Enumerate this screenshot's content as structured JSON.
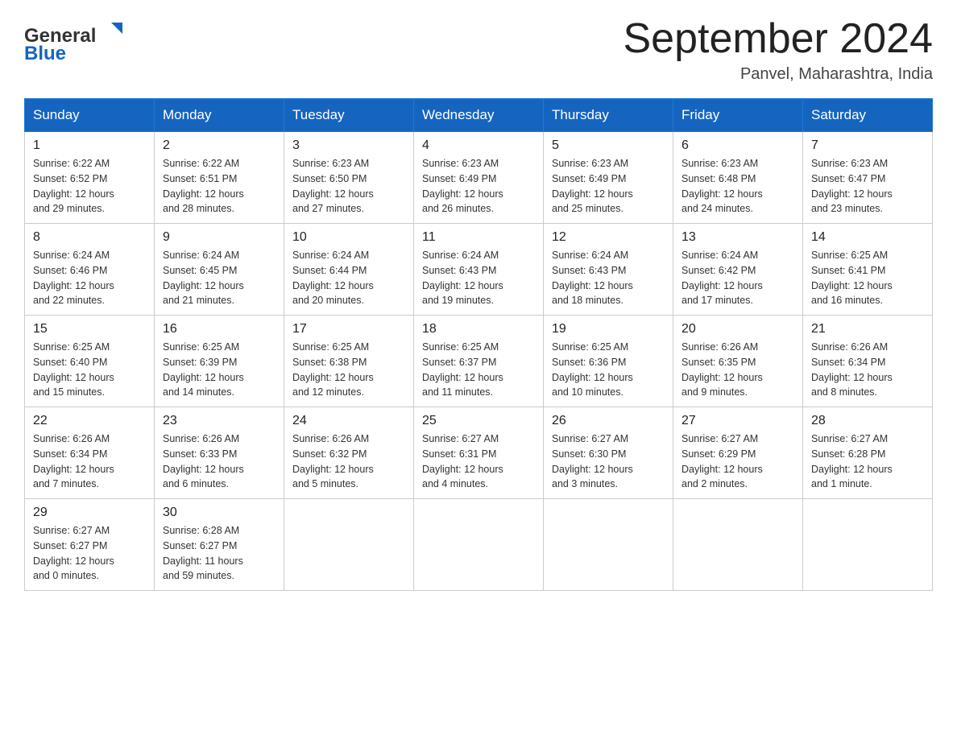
{
  "header": {
    "logo_text_general": "General",
    "logo_text_blue": "Blue",
    "month_title": "September 2024",
    "location": "Panvel, Maharashtra, India"
  },
  "weekdays": [
    "Sunday",
    "Monday",
    "Tuesday",
    "Wednesday",
    "Thursday",
    "Friday",
    "Saturday"
  ],
  "weeks": [
    [
      {
        "day": "1",
        "sunrise": "6:22 AM",
        "sunset": "6:52 PM",
        "daylight": "12 hours and 29 minutes."
      },
      {
        "day": "2",
        "sunrise": "6:22 AM",
        "sunset": "6:51 PM",
        "daylight": "12 hours and 28 minutes."
      },
      {
        "day": "3",
        "sunrise": "6:23 AM",
        "sunset": "6:50 PM",
        "daylight": "12 hours and 27 minutes."
      },
      {
        "day": "4",
        "sunrise": "6:23 AM",
        "sunset": "6:49 PM",
        "daylight": "12 hours and 26 minutes."
      },
      {
        "day": "5",
        "sunrise": "6:23 AM",
        "sunset": "6:49 PM",
        "daylight": "12 hours and 25 minutes."
      },
      {
        "day": "6",
        "sunrise": "6:23 AM",
        "sunset": "6:48 PM",
        "daylight": "12 hours and 24 minutes."
      },
      {
        "day": "7",
        "sunrise": "6:23 AM",
        "sunset": "6:47 PM",
        "daylight": "12 hours and 23 minutes."
      }
    ],
    [
      {
        "day": "8",
        "sunrise": "6:24 AM",
        "sunset": "6:46 PM",
        "daylight": "12 hours and 22 minutes."
      },
      {
        "day": "9",
        "sunrise": "6:24 AM",
        "sunset": "6:45 PM",
        "daylight": "12 hours and 21 minutes."
      },
      {
        "day": "10",
        "sunrise": "6:24 AM",
        "sunset": "6:44 PM",
        "daylight": "12 hours and 20 minutes."
      },
      {
        "day": "11",
        "sunrise": "6:24 AM",
        "sunset": "6:43 PM",
        "daylight": "12 hours and 19 minutes."
      },
      {
        "day": "12",
        "sunrise": "6:24 AM",
        "sunset": "6:43 PM",
        "daylight": "12 hours and 18 minutes."
      },
      {
        "day": "13",
        "sunrise": "6:24 AM",
        "sunset": "6:42 PM",
        "daylight": "12 hours and 17 minutes."
      },
      {
        "day": "14",
        "sunrise": "6:25 AM",
        "sunset": "6:41 PM",
        "daylight": "12 hours and 16 minutes."
      }
    ],
    [
      {
        "day": "15",
        "sunrise": "6:25 AM",
        "sunset": "6:40 PM",
        "daylight": "12 hours and 15 minutes."
      },
      {
        "day": "16",
        "sunrise": "6:25 AM",
        "sunset": "6:39 PM",
        "daylight": "12 hours and 14 minutes."
      },
      {
        "day": "17",
        "sunrise": "6:25 AM",
        "sunset": "6:38 PM",
        "daylight": "12 hours and 12 minutes."
      },
      {
        "day": "18",
        "sunrise": "6:25 AM",
        "sunset": "6:37 PM",
        "daylight": "12 hours and 11 minutes."
      },
      {
        "day": "19",
        "sunrise": "6:25 AM",
        "sunset": "6:36 PM",
        "daylight": "12 hours and 10 minutes."
      },
      {
        "day": "20",
        "sunrise": "6:26 AM",
        "sunset": "6:35 PM",
        "daylight": "12 hours and 9 minutes."
      },
      {
        "day": "21",
        "sunrise": "6:26 AM",
        "sunset": "6:34 PM",
        "daylight": "12 hours and 8 minutes."
      }
    ],
    [
      {
        "day": "22",
        "sunrise": "6:26 AM",
        "sunset": "6:34 PM",
        "daylight": "12 hours and 7 minutes."
      },
      {
        "day": "23",
        "sunrise": "6:26 AM",
        "sunset": "6:33 PM",
        "daylight": "12 hours and 6 minutes."
      },
      {
        "day": "24",
        "sunrise": "6:26 AM",
        "sunset": "6:32 PM",
        "daylight": "12 hours and 5 minutes."
      },
      {
        "day": "25",
        "sunrise": "6:27 AM",
        "sunset": "6:31 PM",
        "daylight": "12 hours and 4 minutes."
      },
      {
        "day": "26",
        "sunrise": "6:27 AM",
        "sunset": "6:30 PM",
        "daylight": "12 hours and 3 minutes."
      },
      {
        "day": "27",
        "sunrise": "6:27 AM",
        "sunset": "6:29 PM",
        "daylight": "12 hours and 2 minutes."
      },
      {
        "day": "28",
        "sunrise": "6:27 AM",
        "sunset": "6:28 PM",
        "daylight": "12 hours and 1 minute."
      }
    ],
    [
      {
        "day": "29",
        "sunrise": "6:27 AM",
        "sunset": "6:27 PM",
        "daylight": "12 hours and 0 minutes."
      },
      {
        "day": "30",
        "sunrise": "6:28 AM",
        "sunset": "6:27 PM",
        "daylight": "11 hours and 59 minutes."
      },
      null,
      null,
      null,
      null,
      null
    ]
  ],
  "labels": {
    "sunrise": "Sunrise:",
    "sunset": "Sunset:",
    "daylight": "Daylight:"
  }
}
